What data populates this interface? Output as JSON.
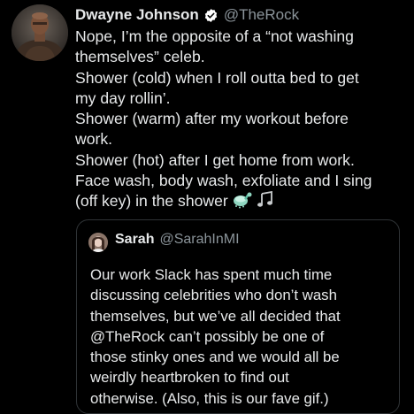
{
  "tweet": {
    "author": {
      "name": "Dwayne Johnson",
      "handle": "@TheRock",
      "verified": true,
      "avatar": "profile-photo"
    },
    "lines": [
      "Nope, I’m the opposite of a “not washing",
      "themselves” celeb.",
      "Shower (cold) when I roll outta bed to get",
      "my day rollin’.",
      "Shower (warm) after my workout before",
      "work.",
      "Shower (hot) after I get home from work.",
      "Face wash, body wash, exfoliate and I sing",
      "(off key) in the shower"
    ],
    "trailing_emojis": [
      "shower-emoji",
      "musical-notes-emoji"
    ]
  },
  "quote": {
    "author": {
      "name": "Sarah",
      "handle": "@SarahInMI",
      "avatar": "profile-photo"
    },
    "lines": [
      "Our work Slack has spent much time",
      "discussing celebrities who don’t wash",
      "themselves, but we’ve all decided that",
      "@TheRock can’t possibly be one of",
      "those stinky ones and we would all be",
      "weirdly heartbroken to find out",
      "otherwise. (Also, this is our fave gif.)"
    ]
  },
  "colors": {
    "background": "#000000",
    "text": "#e7e9ea",
    "secondary_text": "#8b949a",
    "verified_badge": "#ffffff",
    "card_border": "#2f3336"
  }
}
